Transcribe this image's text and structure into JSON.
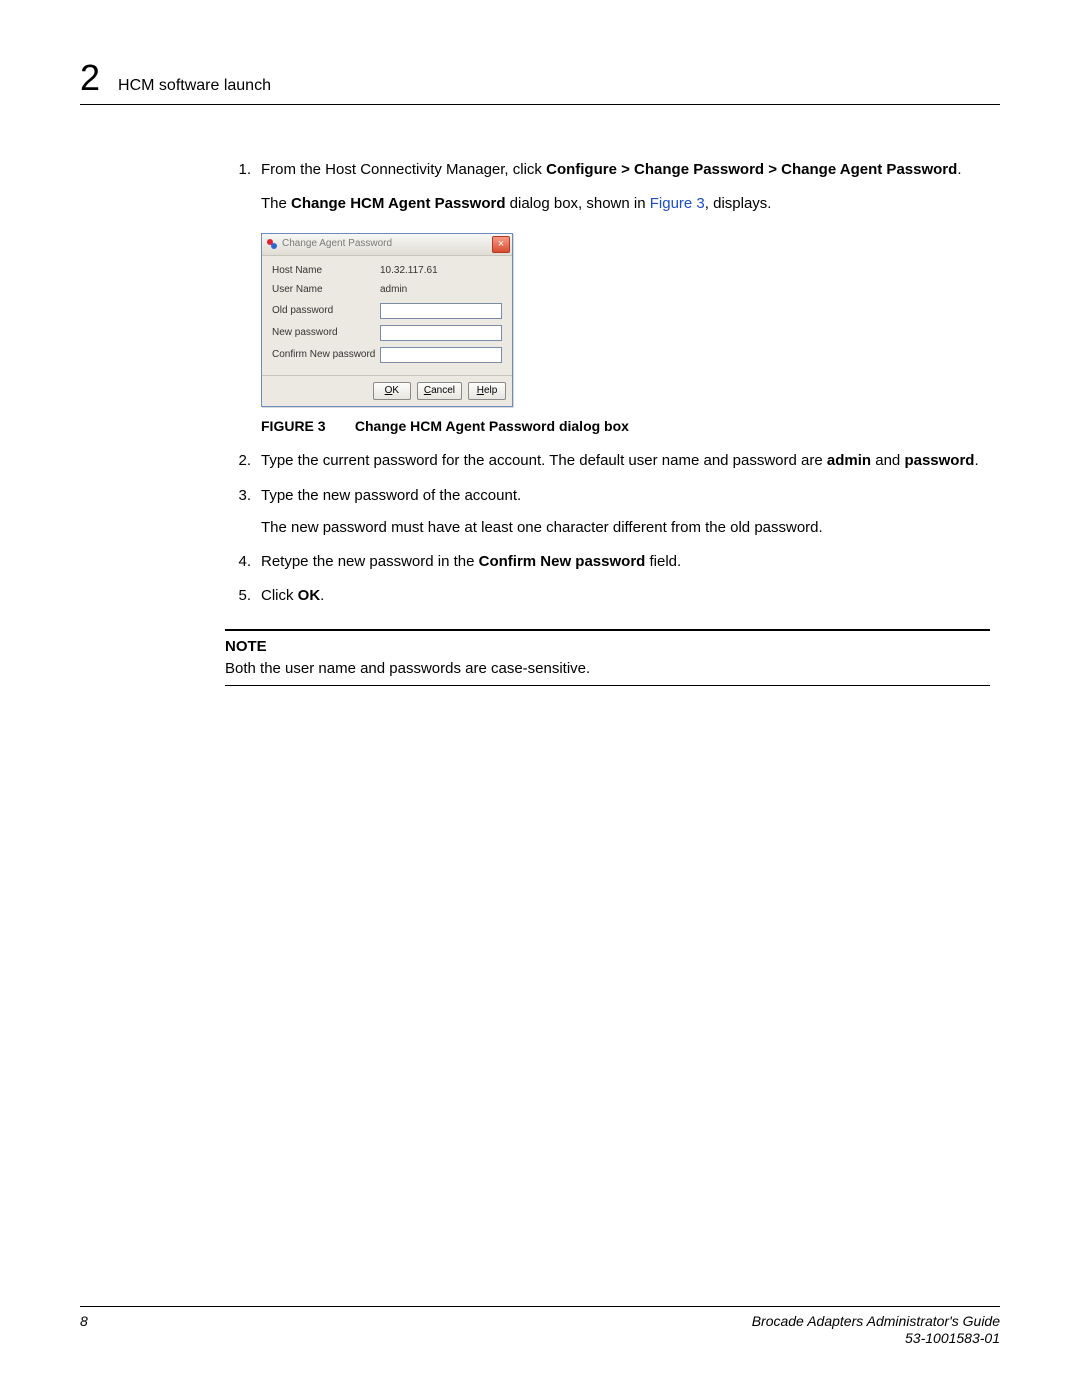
{
  "header": {
    "chapter_number": "2",
    "section_title": "HCM software launch"
  },
  "steps": {
    "s1": {
      "num": "1.",
      "text_pre": "From the Host Connectivity Manager, click ",
      "bold_path": "Configure > Change Password > Change Agent Password",
      "text_post": ".",
      "sub_pre": "The ",
      "sub_bold": "Change HCM Agent Password",
      "sub_mid": " dialog box, shown in ",
      "sub_link": "Figure 3",
      "sub_post": ", displays."
    },
    "s2": {
      "num": "2.",
      "text_pre": "Type the current password for the account. The default user name and password are ",
      "bold1": "admin",
      "mid": " and ",
      "bold2": "password",
      "post": "."
    },
    "s3": {
      "num": "3.",
      "text": "Type the new password of the account.",
      "sub": "The new password must have at least one character different from the old password."
    },
    "s4": {
      "num": "4.",
      "pre": "Retype the new password in the ",
      "bold": "Confirm New password",
      "post": " field."
    },
    "s5": {
      "num": "5.",
      "pre": "Click ",
      "bold": "OK",
      "post": "."
    }
  },
  "dialog": {
    "title": "Change Agent Password",
    "close_label": "×",
    "host_label": "Host Name",
    "host_value": "10.32.117.61",
    "user_label": "User Name",
    "user_value": "admin",
    "old_label": "Old password",
    "new_label": "New password",
    "confirm_label": "Confirm New password",
    "ok_btn": "OK",
    "ok_u": "O",
    "ok_rest": "K",
    "cancel_btn": "Cancel",
    "cancel_u": "C",
    "cancel_rest": "ancel",
    "help_btn": "Help",
    "help_u": "H",
    "help_rest": "elp"
  },
  "figure": {
    "label": "FIGURE 3",
    "title": "Change HCM Agent Password dialog box"
  },
  "note": {
    "heading": "NOTE",
    "text": "Both the user name and passwords are case-sensitive."
  },
  "footer": {
    "page_num": "8",
    "doc_title": "Brocade Adapters Administrator's Guide",
    "doc_id": "53-1001583-01"
  }
}
